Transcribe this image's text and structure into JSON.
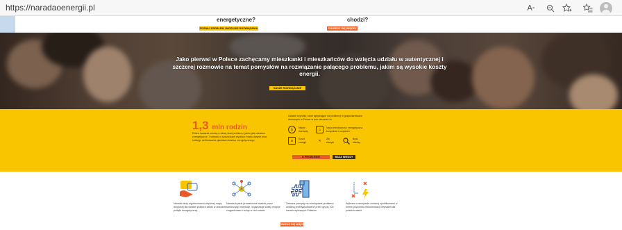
{
  "browser": {
    "url": "https://naradaoenergii.pl",
    "icons": [
      "read-aloud-icon",
      "zoom-icon",
      "add-favorite-icon",
      "favorites-icon",
      "collections-icon",
      "profile-icon"
    ]
  },
  "top_band": {
    "left_question": "energetyczne?",
    "left_button": "POZNAJ PROBLEM I MOŻLIWE ROZWIĄZANIA",
    "right_question": "chodzi?",
    "right_button": "DOWIEDZ SIĘ WIĘCEJ"
  },
  "hero": {
    "text": "Jako pierwsi w Polsce zachęcamy mieszkanki i mieszkańców do wzięcia udziału w autentycznej i szczerej rozmowie na temat pomysłów na rozwiązanie palącego problemu, jakim są wysokie koszty energii.",
    "button": "NASZE ROZWIĄZANIE"
  },
  "stats": {
    "number": "1,3",
    "unit": "mln rodzin",
    "description": "Różne badania mówią o różnej skali problemu, jakim jest ubóstwo energetyczne. Trudność w szacunkach wynika z braku danych oraz ścisłego definiowania zjawiska ubóstwa energetycznego.",
    "intro": "Główne czynniki, które wpływające na problemy w gospodarstwach domowych w Polsce w tym obszarze to:",
    "causes": [
      {
        "icon": "income-icon",
        "label": "Niskie dochody"
      },
      {
        "icon": "house-icon",
        "label": "Niska efektywność energetyczna budynków i urządzeń"
      },
      {
        "icon": "bill-icon",
        "label": "Koszt energii"
      },
      {
        "icon": "heating-icon",
        "label": "Złe nawyki"
      },
      {
        "icon": "magnifier-icon",
        "label": "Brak wiedzy"
      }
    ],
    "button_primary": "O PROBLEMIE",
    "button_secondary": "BAZA WIEDZY"
  },
  "features": [
    {
      "icon": "hand-dialog-icon",
      "text": "Narada służy wypracowaniu wspólnej mapy drogowej dla działań polskich władz w obszarze polityki energetycznej"
    },
    {
      "icon": "network-icon",
      "text": "Narada będzie prowadzona lokalnie przez samorządy, instytucje, organizacje każdy mógł je zorganizować i wziąć w nich udział"
    },
    {
      "icon": "number-one-icon",
      "text": "Zebrane pomysły na rozwiązanie problemu zostaną przedyskutowane przez grupę 100 losowo wybranych Polaków"
    },
    {
      "icon": "decision-icon",
      "text": "Wybrane rozwiązania zostaną opublikowane w formie poziomów rekomendacji obywateli dla polskich władz"
    }
  ],
  "bottom_button": "DOWIEDZ SIĘ WIĘCEJ",
  "colors": {
    "yellow": "#f9c400",
    "orange": "#e85a28",
    "dark": "#3a2a12"
  }
}
